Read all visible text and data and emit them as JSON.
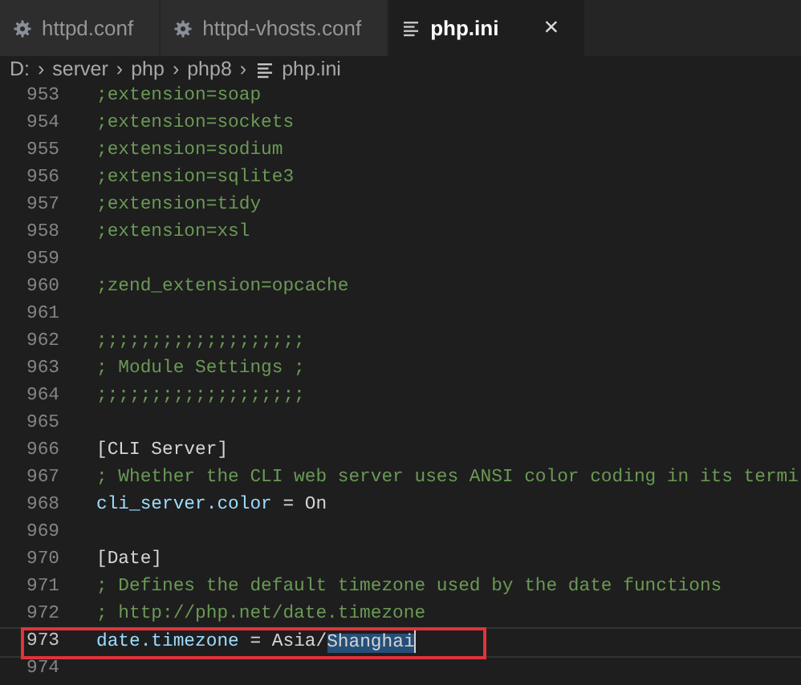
{
  "tabs": [
    {
      "label": "httpd.conf",
      "kind": "gear",
      "selected": false
    },
    {
      "label": "httpd-vhosts.conf",
      "kind": "gear",
      "selected": false
    },
    {
      "label": "php.ini",
      "kind": "lines",
      "selected": true,
      "close_glyph": "×"
    }
  ],
  "breadcrumb": [
    {
      "label": "D:",
      "kind": "folder"
    },
    {
      "label": "server",
      "kind": "folder"
    },
    {
      "label": "php",
      "kind": "folder"
    },
    {
      "label": "php8",
      "kind": "folder"
    },
    {
      "label": "php.ini",
      "kind": "file"
    }
  ],
  "breadcrumb_separator": "›",
  "lines": [
    {
      "number": "953",
      "kind": "comment",
      "text": ";extension=soap",
      "current": false
    },
    {
      "number": "954",
      "kind": "comment",
      "text": ";extension=sockets",
      "current": false
    },
    {
      "number": "955",
      "kind": "comment",
      "text": ";extension=sodium",
      "current": false
    },
    {
      "number": "956",
      "kind": "comment",
      "text": ";extension=sqlite3",
      "current": false
    },
    {
      "number": "957",
      "kind": "comment",
      "text": ";extension=tidy",
      "current": false
    },
    {
      "number": "958",
      "kind": "comment",
      "text": ";extension=xsl",
      "current": false
    },
    {
      "number": "959",
      "kind": "blank",
      "current": false
    },
    {
      "number": "960",
      "kind": "comment",
      "text": ";zend_extension=opcache",
      "current": false
    },
    {
      "number": "961",
      "kind": "blank",
      "current": false
    },
    {
      "number": "962",
      "kind": "comment",
      "text": ";;;;;;;;;;;;;;;;;;;",
      "current": false
    },
    {
      "number": "963",
      "kind": "comment",
      "text": "; Module Settings ;",
      "current": false
    },
    {
      "number": "964",
      "kind": "comment",
      "text": ";;;;;;;;;;;;;;;;;;;",
      "current": false
    },
    {
      "number": "965",
      "kind": "blank",
      "current": false
    },
    {
      "number": "966",
      "kind": "section",
      "text": "[CLI Server]",
      "current": false
    },
    {
      "number": "967",
      "kind": "comment",
      "text": "; Whether the CLI web server uses ANSI color coding in its termi",
      "current": false
    },
    {
      "number": "968",
      "kind": "setting",
      "key": "cli_server.color",
      "operator": "=",
      "value": [
        {
          "text": "On",
          "selected": false
        }
      ],
      "current": false,
      "annotated": false
    },
    {
      "number": "969",
      "kind": "blank",
      "current": false
    },
    {
      "number": "970",
      "kind": "section",
      "text": "[Date]",
      "current": false
    },
    {
      "number": "971",
      "kind": "comment",
      "text": "; Defines the default timezone used by the date functions",
      "current": false
    },
    {
      "number": "972",
      "kind": "comment",
      "text": "; http://php.net/date.timezone",
      "current": false
    },
    {
      "number": "973",
      "kind": "setting",
      "key": "date.timezone",
      "operator": "=",
      "value": [
        {
          "text": "Asia/",
          "selected": false
        },
        {
          "text": "Shanghai",
          "selected": true
        }
      ],
      "current": true,
      "annotated": true
    },
    {
      "number": "974",
      "kind": "blank",
      "current": false
    }
  ]
}
